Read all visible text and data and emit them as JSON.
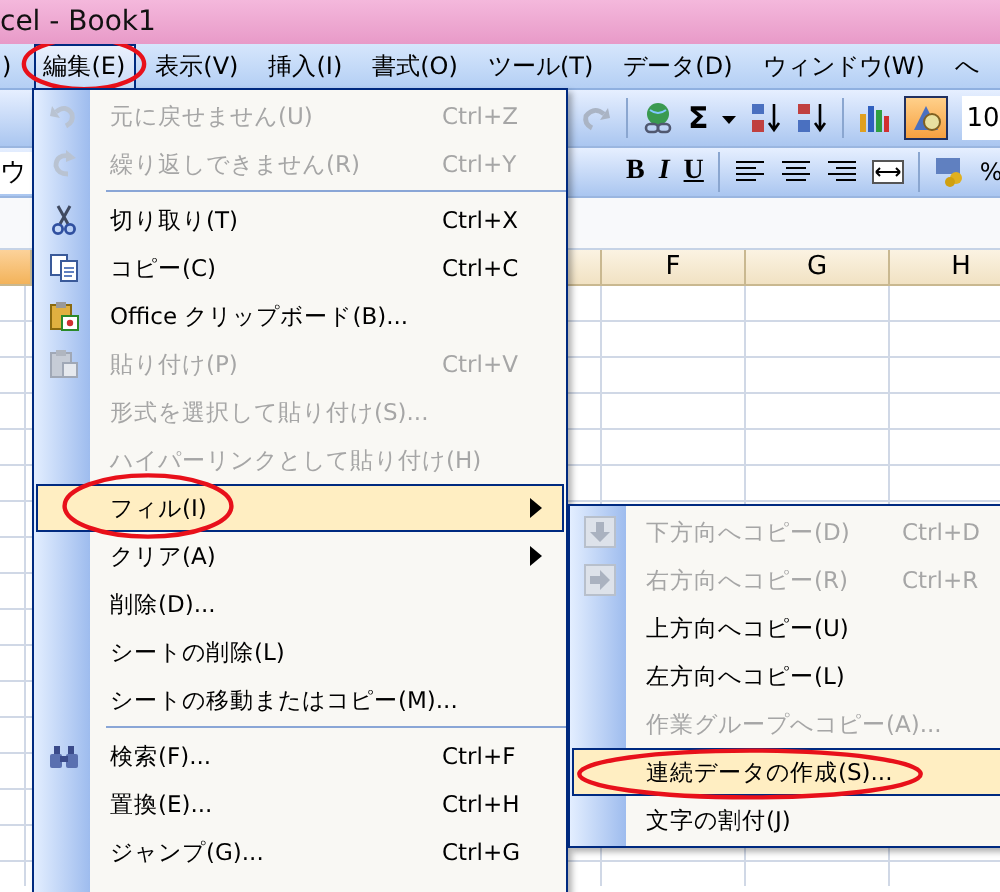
{
  "window": {
    "title": "cel - Book1"
  },
  "menu_bar": [
    {
      "label": ")",
      "selected": false,
      "circled": false
    },
    {
      "label": "編集(E)",
      "selected": true,
      "circled": true
    },
    {
      "label": "表示(V)",
      "selected": false,
      "circled": false
    },
    {
      "label": "挿入(I)",
      "selected": false,
      "circled": false
    },
    {
      "label": "書式(O)",
      "selected": false,
      "circled": false
    },
    {
      "label": "ツール(T)",
      "selected": false,
      "circled": false
    },
    {
      "label": "データ(D)",
      "selected": false,
      "circled": false
    },
    {
      "label": "ウィンドウ(W)",
      "selected": false,
      "circled": false
    },
    {
      "label": "へ",
      "selected": false,
      "circled": false
    }
  ],
  "standard_toolbar": {
    "sum_symbol": "Σ",
    "zoom_value": "10"
  },
  "formatting_toolbar": {
    "font_value": "ウ",
    "buttons": [
      "B",
      "I",
      "U"
    ],
    "percent": "%"
  },
  "columns": [
    "F",
    "G",
    "H"
  ],
  "edit_menu": [
    {
      "kind": "item",
      "label": "元に戻せません(U)",
      "shortcut": "Ctrl+Z",
      "disabled": true,
      "selected": false,
      "submenu": false,
      "circled": false
    },
    {
      "kind": "item",
      "label": "繰り返しできません(R)",
      "shortcut": "Ctrl+Y",
      "disabled": true,
      "selected": false,
      "submenu": false,
      "circled": false
    },
    {
      "kind": "separator"
    },
    {
      "kind": "item",
      "label": "切り取り(T)",
      "shortcut": "Ctrl+X",
      "disabled": false,
      "selected": false,
      "submenu": false,
      "circled": false
    },
    {
      "kind": "item",
      "label": "コピー(C)",
      "shortcut": "Ctrl+C",
      "disabled": false,
      "selected": false,
      "submenu": false,
      "circled": false
    },
    {
      "kind": "item",
      "label": "Office クリップボード(B)...",
      "disabled": false,
      "selected": false,
      "submenu": false,
      "circled": false
    },
    {
      "kind": "item",
      "label": "貼り付け(P)",
      "shortcut": "Ctrl+V",
      "disabled": true,
      "selected": false,
      "submenu": false,
      "circled": false
    },
    {
      "kind": "item",
      "label": "形式を選択して貼り付け(S)...",
      "disabled": true,
      "selected": false,
      "submenu": false,
      "circled": false
    },
    {
      "kind": "item",
      "label": "ハイパーリンクとして貼り付け(H)",
      "disabled": true,
      "selected": false,
      "submenu": false,
      "circled": false
    },
    {
      "kind": "item",
      "label": "フィル(I)",
      "disabled": false,
      "selected": true,
      "submenu": true,
      "circled": true
    },
    {
      "kind": "item",
      "label": "クリア(A)",
      "disabled": false,
      "selected": false,
      "submenu": true,
      "circled": false
    },
    {
      "kind": "item",
      "label": "削除(D)...",
      "disabled": false,
      "selected": false,
      "submenu": false,
      "circled": false
    },
    {
      "kind": "item",
      "label": "シートの削除(L)",
      "disabled": false,
      "selected": false,
      "submenu": false,
      "circled": false
    },
    {
      "kind": "item",
      "label": "シートの移動またはコピー(M)...",
      "disabled": false,
      "selected": false,
      "submenu": false,
      "circled": false
    },
    {
      "kind": "separator"
    },
    {
      "kind": "item",
      "label": "検索(F)...",
      "shortcut": "Ctrl+F",
      "disabled": false,
      "selected": false,
      "submenu": false,
      "circled": false
    },
    {
      "kind": "item",
      "label": "置換(E)...",
      "shortcut": "Ctrl+H",
      "disabled": false,
      "selected": false,
      "submenu": false,
      "circled": false
    },
    {
      "kind": "item",
      "label": "ジャンプ(G)...",
      "shortcut": "Ctrl+G",
      "disabled": false,
      "selected": false,
      "submenu": false,
      "circled": false
    }
  ],
  "fill_submenu": [
    {
      "kind": "item",
      "label": "下方向へコピー(D)",
      "shortcut": "Ctrl+D",
      "disabled": true,
      "selected": false,
      "circled": false
    },
    {
      "kind": "item",
      "label": "右方向へコピー(R)",
      "shortcut": "Ctrl+R",
      "disabled": true,
      "selected": false,
      "circled": false
    },
    {
      "kind": "item",
      "label": "上方向へコピー(U)",
      "disabled": false,
      "selected": false,
      "circled": false
    },
    {
      "kind": "item",
      "label": "左方向へコピー(L)",
      "disabled": false,
      "selected": false,
      "circled": false
    },
    {
      "kind": "item",
      "label": "作業グループへコピー(A)...",
      "disabled": true,
      "selected": false,
      "circled": false
    },
    {
      "kind": "item",
      "label": "連続データの作成(S)...",
      "disabled": false,
      "selected": true,
      "circled": true
    },
    {
      "kind": "item",
      "label": "文字の割付(J)",
      "disabled": false,
      "selected": false,
      "circled": false
    }
  ]
}
